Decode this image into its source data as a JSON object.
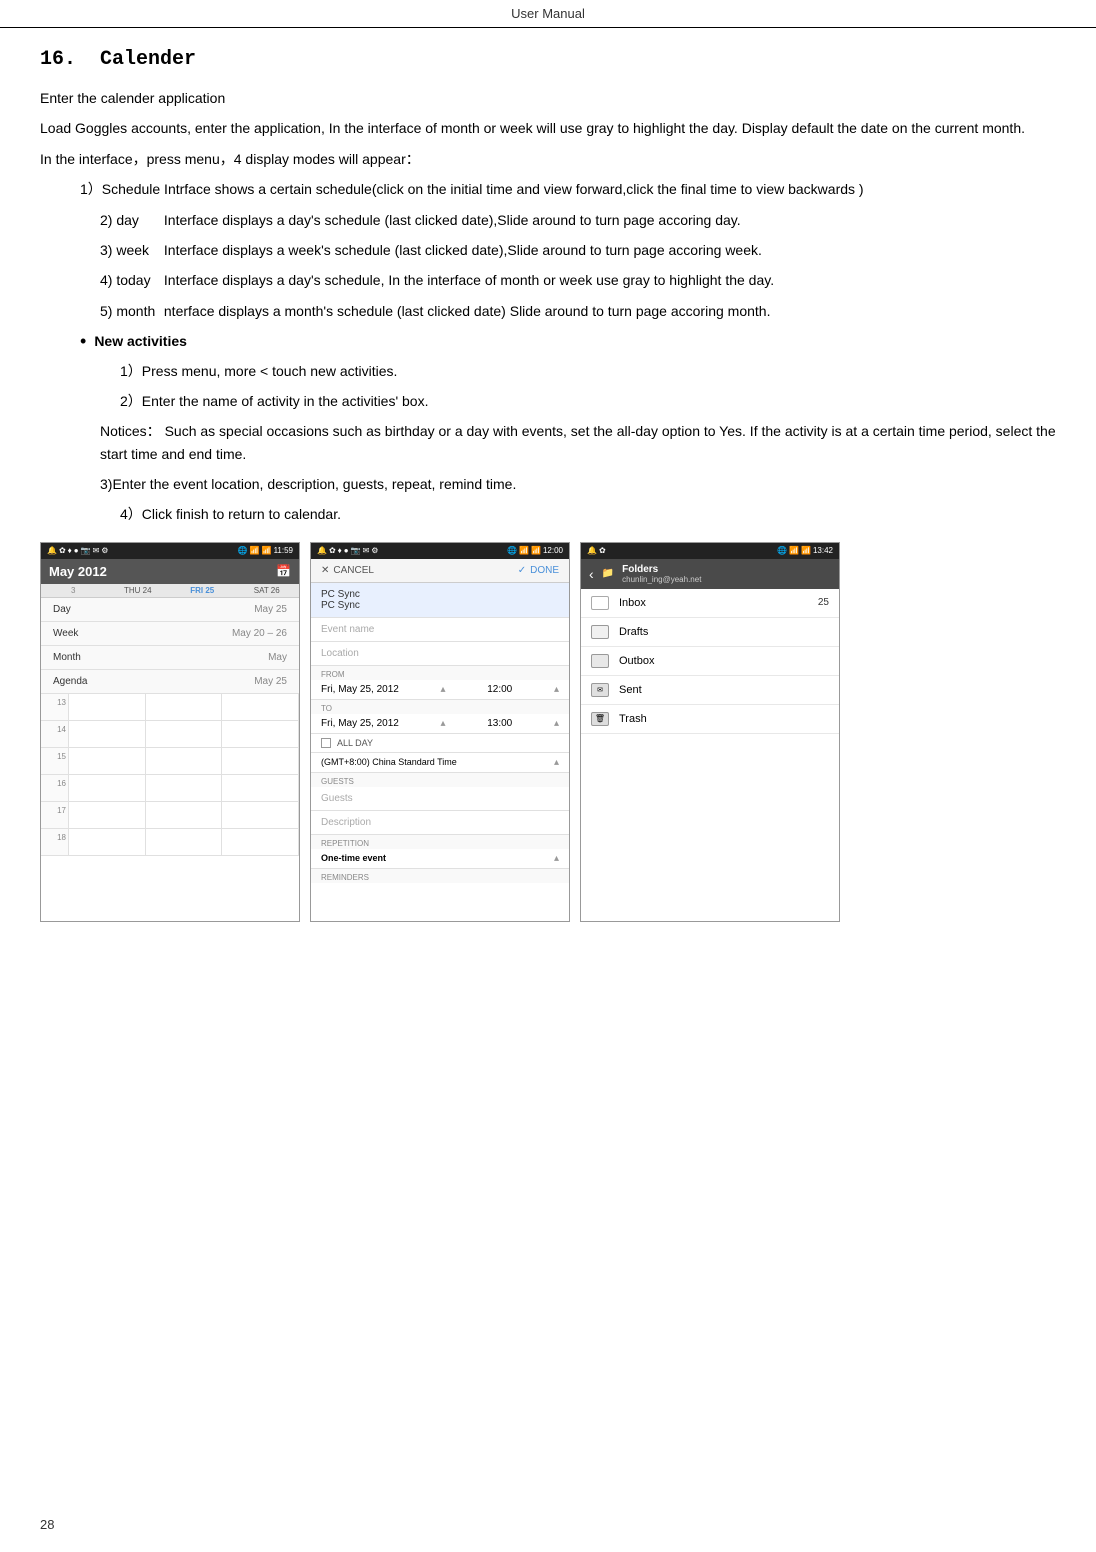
{
  "header": {
    "text": "User    Manual"
  },
  "section": {
    "number": "16.",
    "title": "Calender"
  },
  "content": {
    "para1": "Enter the calender application",
    "para2": "Load Goggles accounts, enter the application, In the interface of month or week will use gray to highlight the day. Display default the date on the current month.",
    "para3": "In the interface，press menu，4 display modes will appear：",
    "item1": "1）Schedule Intrface shows a certain schedule(click on the initial time and view forward,click the final time to view backwards )",
    "item2_label": "2) day",
    "item2_text": "Interface displays a day's schedule (last clicked date),Slide around to turn page accoring day.",
    "item3_label": "3) week",
    "item3_text": "Interface displays a    week's schedule (last clicked date),Slide around to turn page accoring week.",
    "item4_label": "4) today",
    "item4_text": "Interface displays a day's schedule, In the interface of month or week use gray to highlight the day.",
    "item5_label": "5) month",
    "item5_text": "nterface displays a    month's schedule (last clicked date) Slide around to turn page accoring month.",
    "bullet_label": "New activities",
    "step1": "1）Press menu, more < touch new activities.",
    "step2": "2）Enter the name of activity in the activities' box.",
    "notices_label": "Notices：",
    "notices_text": "Such as special occasions such as birthday or a day with events, set the all-day option to Yes. If the activity is at a certain time period, select the start time and end time.",
    "step3": "3)Enter the event location, description, guests, repeat, remind time.",
    "step4": "4）Click finish to return to calendar."
  },
  "screenshots": {
    "calendar": {
      "status_bar": "🔔 ✿ ♦ ● 📷 ✉ ⚙ 🌐 📶 📶 11:59",
      "month_year": "May 2012",
      "weekdays": [
        "3",
        "THU 24",
        "FRI 25",
        "SAT 26"
      ],
      "menu_items": [
        {
          "label": "Day",
          "value": "May 25"
        },
        {
          "label": "Week",
          "value": "May 20 – 26"
        },
        {
          "label": "Month",
          "value": "May"
        },
        {
          "label": "Agenda",
          "value": "May 25"
        }
      ],
      "times": [
        "13",
        "14",
        "15",
        "16",
        "17",
        "18"
      ]
    },
    "add_event": {
      "status_bar": "🔔 ✿ ♦ ● 📷 ✉ ⚙ 🌐 📶 📶 12:00",
      "cancel_label": "CANCEL",
      "done_label": "DONE",
      "calendar_label": "PC Sync",
      "calendar_value": "PC Sync",
      "event_name_placeholder": "Event name",
      "location_placeholder": "Location",
      "from_label": "FROM",
      "from_date": "Fri, May 25, 2012",
      "from_time": "12:00",
      "to_label": "TO",
      "to_date": "Fri, May 25, 2012",
      "to_time": "13:00",
      "all_day_label": "ALL DAY",
      "timezone": "(GMT+8:00) China Standard Time",
      "guests_label": "GUESTS",
      "guests_placeholder": "Guests",
      "description_placeholder": "Description",
      "repetition_label": "REPETITION",
      "repetition_value": "One-time event",
      "reminders_label": "REMINDERS"
    },
    "email": {
      "status_bar": "🔔 ✿ 🌐 📶 📶 13:42",
      "account_name": "Folders",
      "account_email": "chunlin_ing@yeah.net",
      "folders": [
        {
          "name": "Inbox",
          "badge": "25",
          "icon": "inbox"
        },
        {
          "name": "Drafts",
          "badge": "",
          "icon": "drafts"
        },
        {
          "name": "Outbox",
          "badge": "",
          "icon": "outbox"
        },
        {
          "name": "Sent",
          "badge": "",
          "icon": "sent"
        },
        {
          "name": "Trash",
          "badge": "",
          "icon": "trash"
        }
      ]
    }
  },
  "page_number": "28"
}
